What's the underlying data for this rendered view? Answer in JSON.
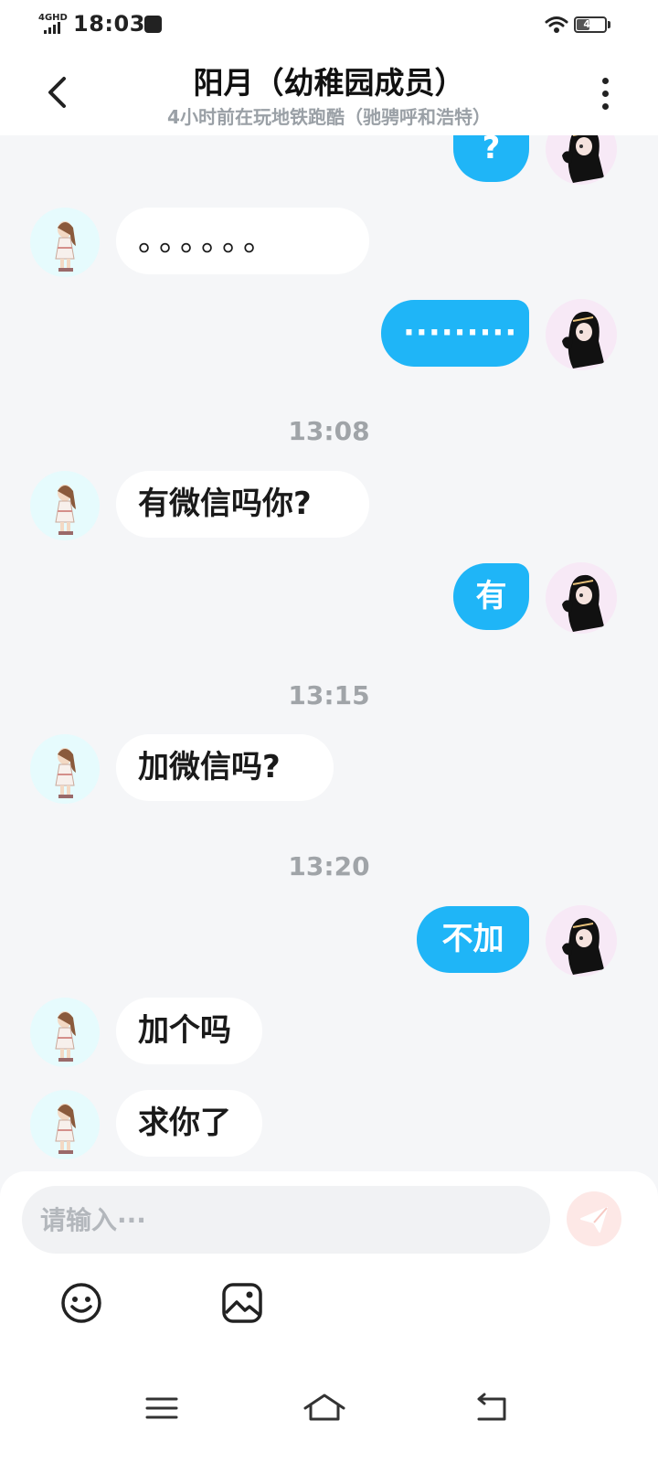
{
  "status_bar": {
    "network": "4GHD",
    "time": "18:03",
    "battery": "46",
    "battery_level": 0.46
  },
  "header": {
    "title": "阳月（幼稚园成员）",
    "subtitle": "4小时前在玩地铁跑酷（驰骋呼和浩特）"
  },
  "messages": [
    {
      "from": "me",
      "text": "?"
    },
    {
      "from": "them",
      "text": "。。。。。。"
    },
    {
      "from": "me",
      "text": "·········"
    },
    {
      "timestamp": "13:08"
    },
    {
      "from": "them",
      "text": "有微信吗你?"
    },
    {
      "from": "me",
      "text": "有"
    },
    {
      "timestamp": "13:15"
    },
    {
      "from": "them",
      "text": "加微信吗?"
    },
    {
      "timestamp": "13:20"
    },
    {
      "from": "me",
      "text": "不加"
    },
    {
      "from": "them",
      "text": "加个吗"
    },
    {
      "from": "them",
      "text": "求你了"
    }
  ],
  "composer": {
    "placeholder": "请输入···"
  },
  "colors": {
    "outgoing_bubble": "#1fb5f7",
    "incoming_bubble": "#ffffff",
    "background": "#f5f6f8",
    "send_button": "#fde8e6"
  },
  "icons": {
    "back": "chevron-left-icon",
    "more": "more-vertical-icon",
    "send": "send-icon",
    "emoji": "emoji-icon",
    "image": "image-icon",
    "menu": "menu-icon",
    "home": "home-icon",
    "back_nav": "back-nav-icon"
  }
}
